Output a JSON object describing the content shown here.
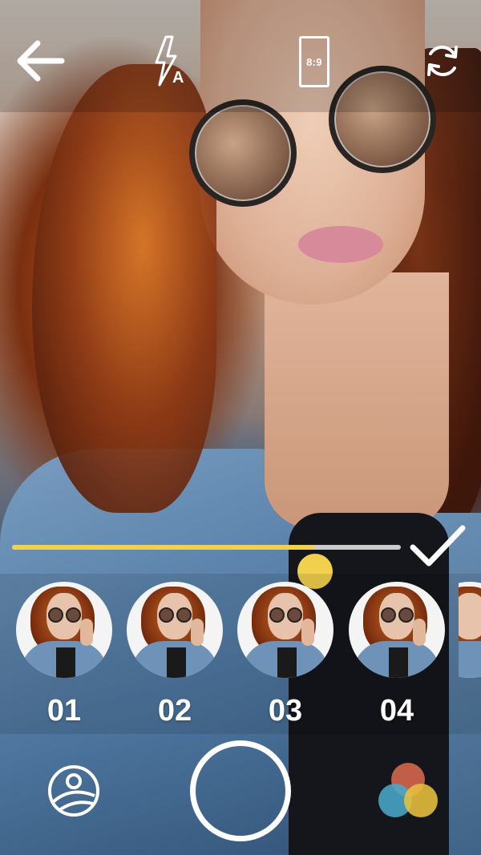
{
  "top_bar": {
    "back_icon": "arrow-left-icon",
    "flash_icon": "flash-auto-icon",
    "flash_mode_letter": "A",
    "aspect_ratio_label": "8:9",
    "switch_camera_icon": "camera-switch-icon"
  },
  "adjustment": {
    "slider_value_fraction": 0.78,
    "confirm_icon": "checkmark-icon",
    "accent_color": "#f1d04d"
  },
  "filters": [
    {
      "label": "01"
    },
    {
      "label": "02"
    },
    {
      "label": "03"
    },
    {
      "label": "04"
    }
  ],
  "bottom_bar": {
    "gallery_icon": "gallery-icon",
    "shutter_icon": "shutter-ring-icon",
    "color_icon": "color-palette-icon",
    "palette_colors": [
      "#d8694f",
      "#4aa7c9",
      "#e7c13e"
    ]
  }
}
